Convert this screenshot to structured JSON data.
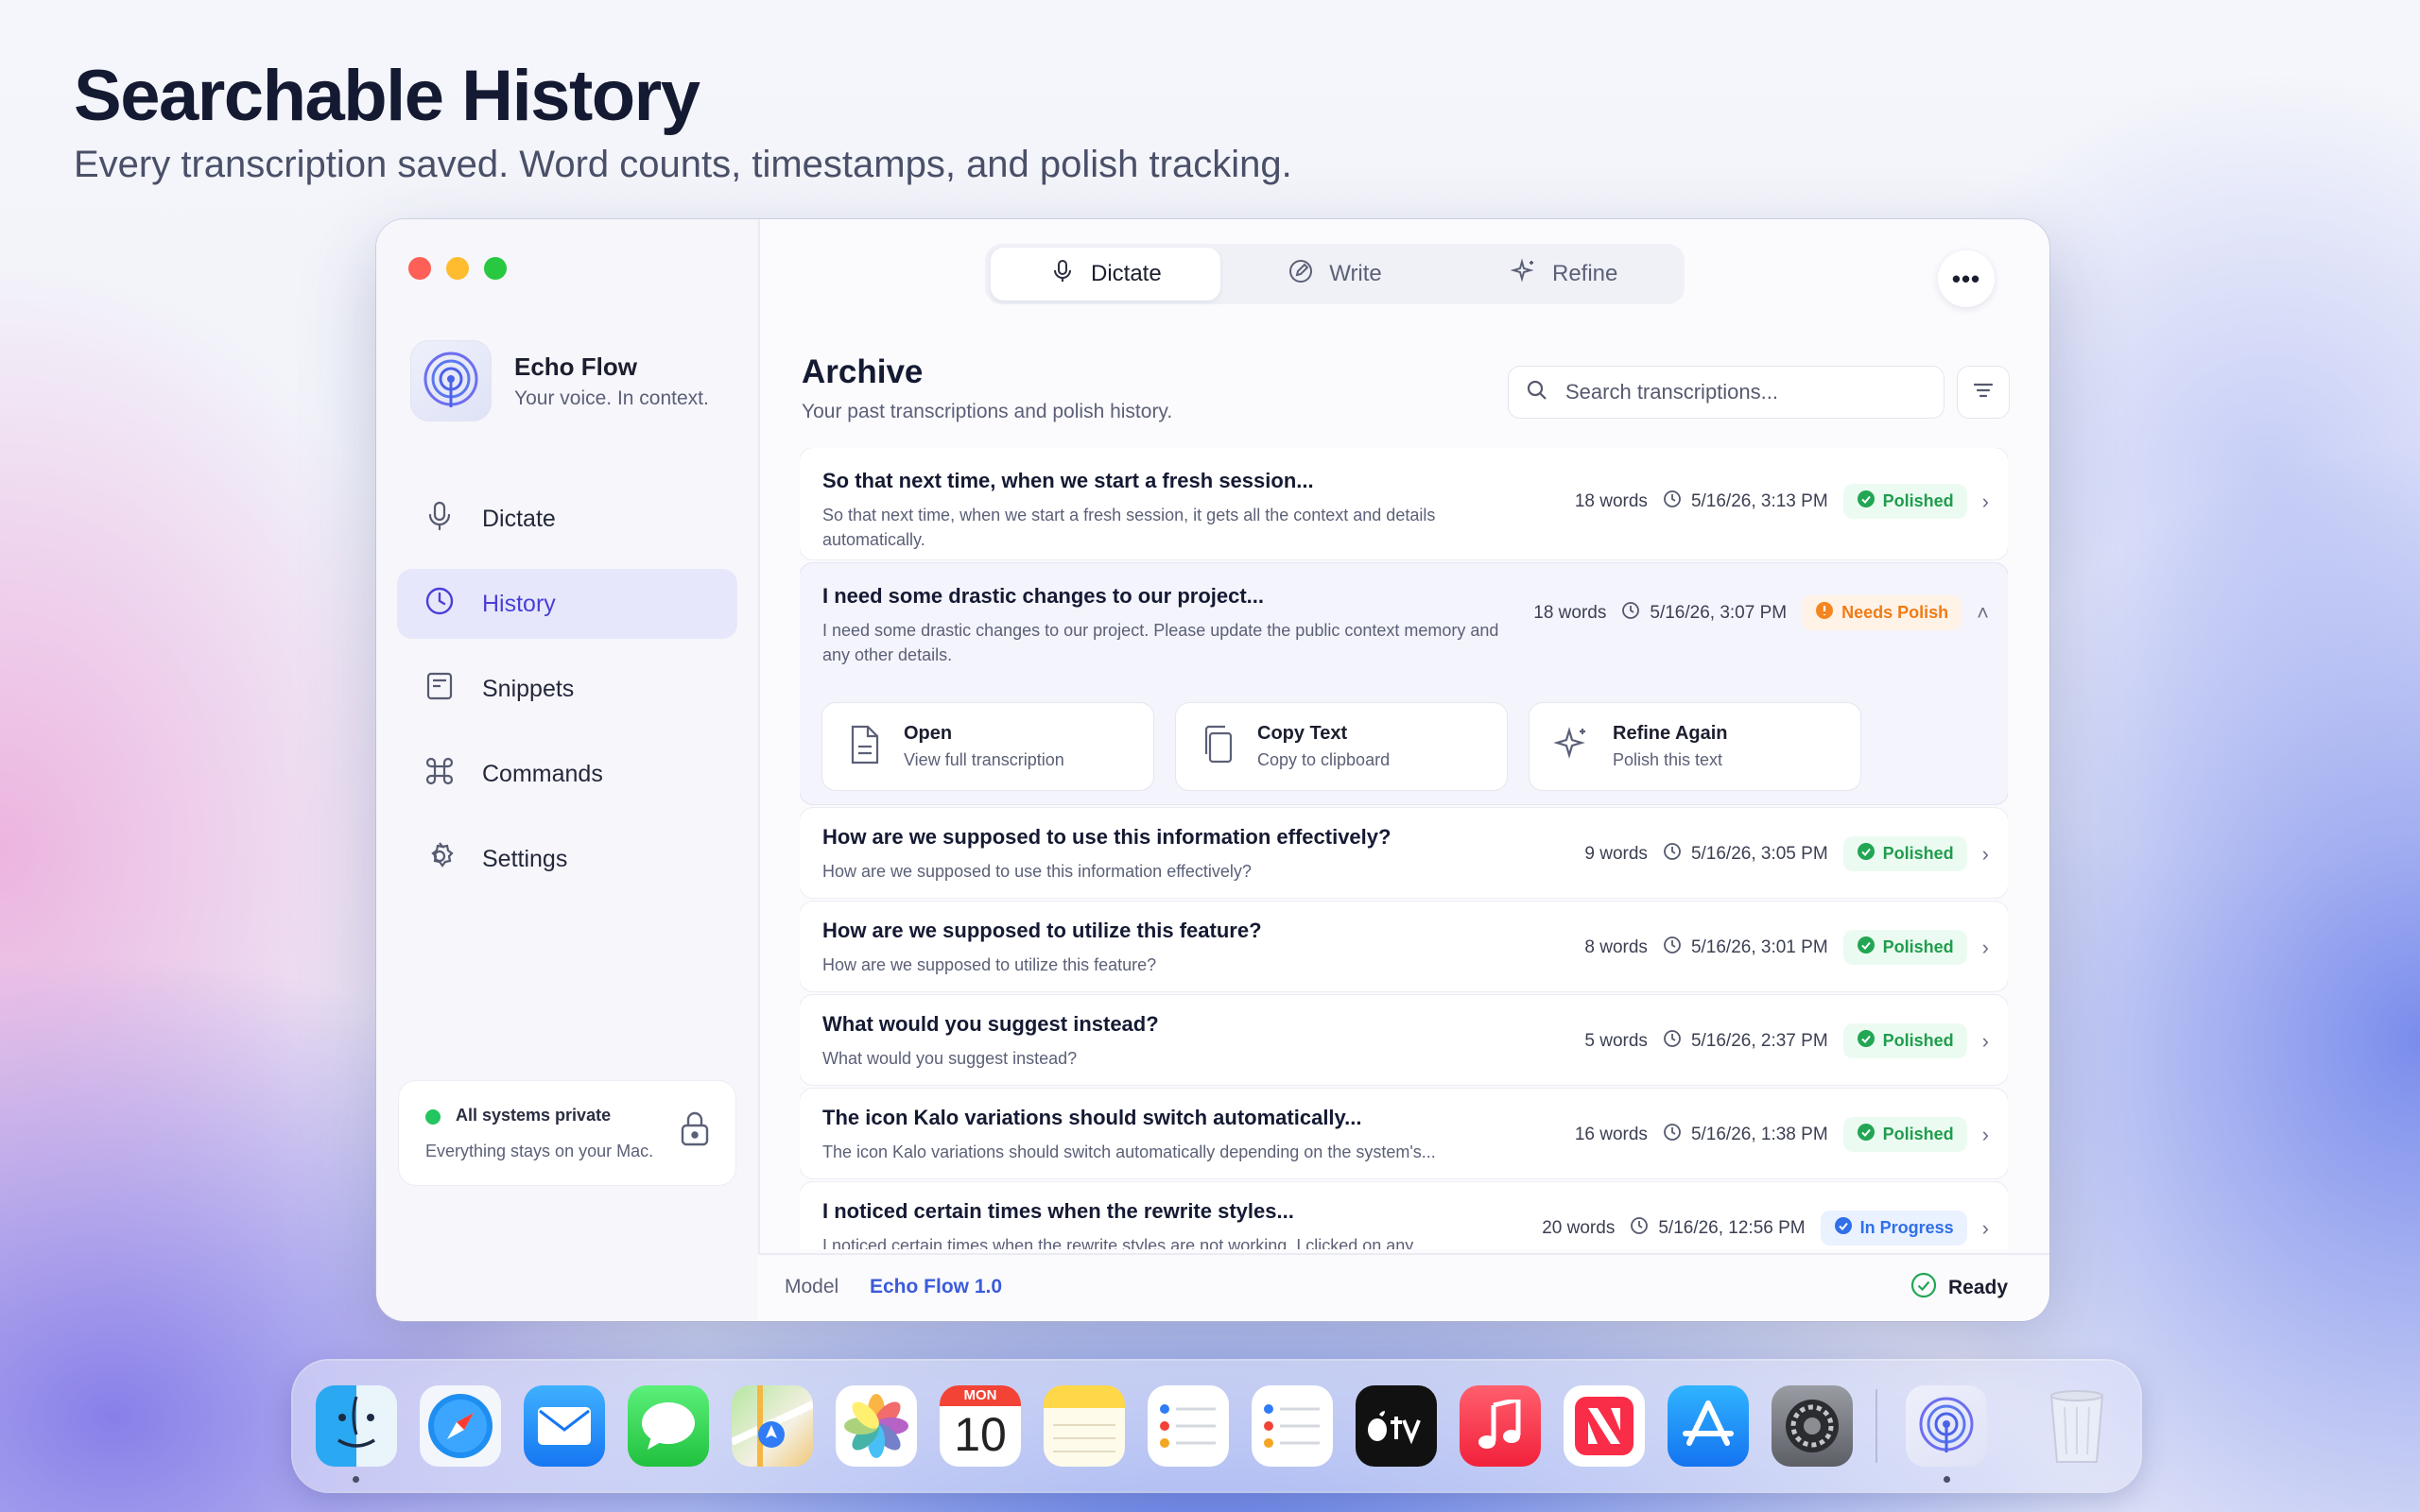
{
  "hero": {
    "title": "Searchable History",
    "subtitle": "Every transcription saved. Word counts, timestamps, and polish tracking."
  },
  "app": {
    "name": "Echo Flow",
    "tagline": "Your voice. In context."
  },
  "modes": [
    {
      "label": "Dictate",
      "icon": "microphone-icon",
      "active": true
    },
    {
      "label": "Write",
      "icon": "pen-icon",
      "active": false
    },
    {
      "label": "Refine",
      "icon": "sparkle-icon",
      "active": false
    }
  ],
  "sidebar": {
    "items": [
      {
        "label": "Dictate",
        "icon": "microphone-icon"
      },
      {
        "label": "History",
        "icon": "clock-icon",
        "active": true
      },
      {
        "label": "Snippets",
        "icon": "snippet-icon"
      },
      {
        "label": "Commands",
        "icon": "command-icon"
      },
      {
        "label": "Settings",
        "icon": "gear-icon"
      }
    ],
    "privacy": {
      "title": "All systems private",
      "subtitle": "Everything stays on your Mac."
    }
  },
  "archive": {
    "title": "Archive",
    "subtitle": "Your past transcriptions and polish history.",
    "search_placeholder": "Search transcriptions..."
  },
  "entries": [
    {
      "title": "So that next time, when we start a fresh session...",
      "preview": "So that next time, when we start a fresh session, it gets all the context and details automatically.",
      "words": "18 words",
      "time": "5/16/26, 3:13 PM",
      "status": "Polished"
    },
    {
      "title": "I need some drastic changes to our project...",
      "preview": "I need some drastic changes to our project. Please update the public context memory and any other details.",
      "words": "18 words",
      "time": "5/16/26, 3:07 PM",
      "status": "Needs Polish",
      "expanded": true
    },
    {
      "title": "How are we supposed to use this information effectively?",
      "preview": "How are we supposed to use this information effectively?",
      "words": "9 words",
      "time": "5/16/26, 3:05 PM",
      "status": "Polished"
    },
    {
      "title": "How are we supposed to utilize this feature?",
      "preview": "How are we supposed to utilize this feature?",
      "words": "8 words",
      "time": "5/16/26, 3:01 PM",
      "status": "Polished"
    },
    {
      "title": "What would you suggest instead?",
      "preview": "What would you suggest instead?",
      "words": "5 words",
      "time": "5/16/26, 2:37 PM",
      "status": "Polished"
    },
    {
      "title": "The icon Kalo variations should switch automatically...",
      "preview": "The icon Kalo variations should switch automatically depending on the system's...",
      "words": "16 words",
      "time": "5/16/26, 1:38 PM",
      "status": "Polished"
    },
    {
      "title": "I noticed certain times when the rewrite styles...",
      "preview": "I noticed certain times when the rewrite styles are not working. I clicked on any...",
      "words": "20 words",
      "time": "5/16/26, 12:56 PM",
      "status": "In Progress"
    }
  ],
  "actions": [
    {
      "title": "Open",
      "subtitle": "View full transcription",
      "icon": "document-icon"
    },
    {
      "title": "Copy Text",
      "subtitle": "Copy to clipboard",
      "icon": "copy-icon"
    },
    {
      "title": "Refine Again",
      "subtitle": "Polish this text",
      "icon": "sparkle-icon"
    }
  ],
  "statusbar": {
    "model_label": "Model",
    "model_value": "Echo Flow 1.0",
    "ready": "Ready"
  },
  "dock": {
    "calendar_month": "MON",
    "calendar_day": "10",
    "apps": [
      "finder-icon",
      "safari-icon",
      "mail-icon",
      "messages-icon",
      "maps-icon",
      "photos-icon",
      "calendar-icon",
      "notes-icon",
      "reminders-icon",
      "reminders-icon",
      "apple-tv-icon",
      "music-icon",
      "news-icon",
      "app-store-icon",
      "system-settings-icon",
      "echo-flow-icon",
      "trash-icon"
    ]
  },
  "colors": {
    "accent": "#4a3fd6",
    "polished": "#1f9d4d",
    "needs_polish": "#f07b16",
    "in_progress": "#2f6fe8"
  }
}
